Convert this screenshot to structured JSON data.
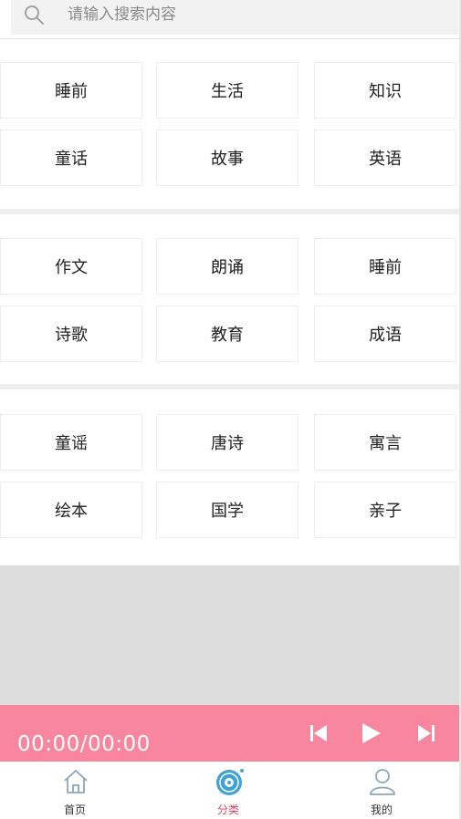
{
  "search": {
    "placeholder": "请输入搜索内容"
  },
  "categories": [
    [
      "睡前",
      "生活",
      "知识",
      "童话",
      "故事",
      "英语"
    ],
    [
      "作文",
      "朗诵",
      "睡前",
      "诗歌",
      "教育",
      "成语"
    ],
    [
      "童谣",
      "唐诗",
      "寓言",
      "绘本",
      "国学",
      "亲子"
    ]
  ],
  "player": {
    "time": "00:00/00:00"
  },
  "tabs": [
    {
      "label": "首页",
      "icon": "home-icon"
    },
    {
      "label": "分类",
      "icon": "disc-icon"
    },
    {
      "label": "我的",
      "icon": "user-icon"
    }
  ],
  "colors": {
    "accent": "#f7869e",
    "active_tab": "#e0465f"
  }
}
